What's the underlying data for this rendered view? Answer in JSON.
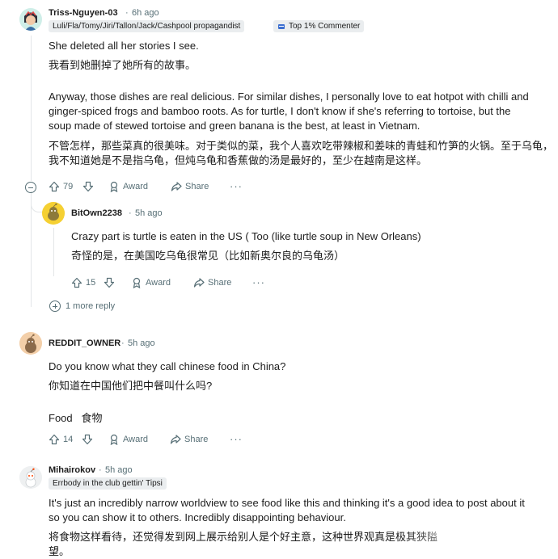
{
  "colors": {
    "meta": "#576f76",
    "flair_bg": "#eaedef",
    "thread_line": "#e3e6e8",
    "text": "#1c1c1c"
  },
  "comments": [
    {
      "author": "Triss-Nguyen-03",
      "dot": "·",
      "time": "6h ago",
      "flair": "Luli/Fla/Tomy/Jiri/Tallon/Jack/Cashpool propagandist",
      "badge": "Top 1% Commenter",
      "lines": [
        "She deleted all her stories I see.",
        "我看到她删掉了她所有的故事。",
        "Anyway, those dishes are real delicious. For similar dishes, I personally love to eat hotpot with chilli and",
        "ginger-spiced frogs and bamboo roots. As for turtle, I don't know if she's referring to tortoise, but the",
        "soup made of stewed tortoise and green banana is the best, at least in Vietnam.",
        "不管怎样，那些菜真的很美味。对于类似的菜，我个人喜欢吃带辣椒和姜味的青蛙和竹笋的火锅。至于乌龟，",
        "我不知道她是不是指乌龟，但炖乌龟和香蕉做的汤是最好的，至少在越南是这样。"
      ],
      "votes": "79",
      "award": "Award",
      "share": "Share",
      "more": "···"
    },
    {
      "author": "BitOwn2238",
      "dot": "·",
      "time": "5h ago",
      "lines": [
        "Crazy part is turtle is eaten in the US ( Too (like turtle soup in New Orleans)",
        "奇怪的是，在美国吃乌龟很常见（比如新奥尔良的乌龟汤）"
      ],
      "votes": "15",
      "award": "Award",
      "share": "Share",
      "more": "···"
    },
    {
      "author": "REDDIT_OWNER",
      "dot": "·",
      "time": "5h ago",
      "lines": [
        "Do you know what they call chinese food in China?",
        "你知道在中国他们把中餐叫什么吗?",
        "Food   食物"
      ],
      "votes": "14",
      "award": "Award",
      "share": "Share",
      "more": "···"
    },
    {
      "author": "Mihairokov",
      "dot": "·",
      "time": "5h ago",
      "flair": "Errbody in the club gettin' Tipsi",
      "lines": [
        "It's just an incredibly narrow worldview to see food like this and thinking it's a good idea to post about it",
        "so you can show it to others. Incredibly disappointing behaviour.",
        "将食物这样看待，还觉得发到网上展示给别人是个好主意，这种世界观真是极其狭隘",
        "望。"
      ]
    }
  ],
  "more_replies": "1 more reply"
}
